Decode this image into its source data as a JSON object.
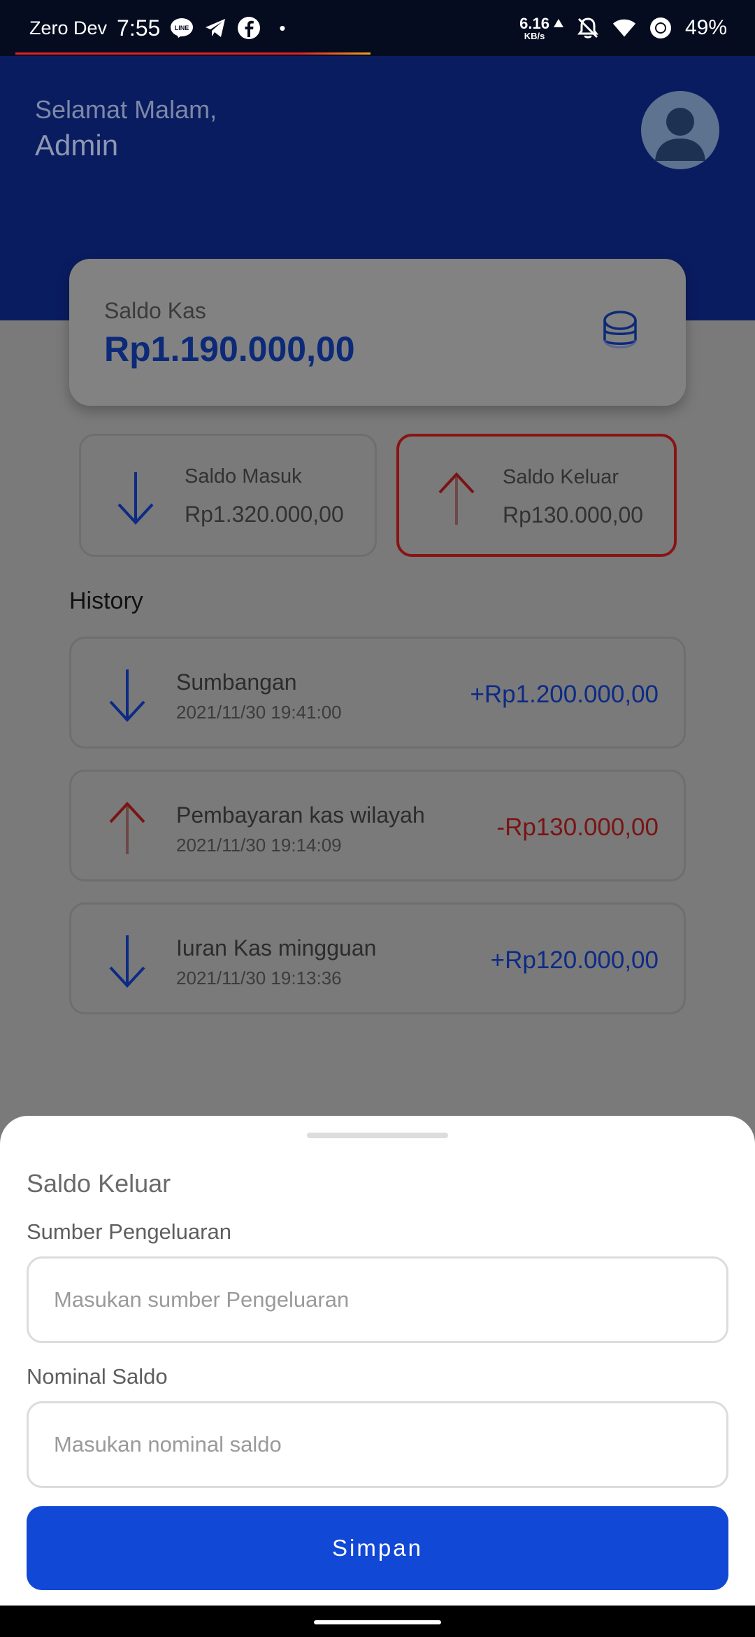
{
  "status_bar": {
    "carrier": "Zero Dev",
    "time": "7:55",
    "net_speed_value": "6.16",
    "net_speed_unit": "KB/s",
    "battery": "49%",
    "icons": [
      "line-icon",
      "telegram-icon",
      "facebook-icon",
      "dot",
      "upload-arrow-icon",
      "bell-off-icon",
      "wifi-icon",
      "battery-saver-icon"
    ]
  },
  "header": {
    "greeting": "Selamat Malam,",
    "user_name": "Admin"
  },
  "balance": {
    "label": "Saldo Kas",
    "value": "Rp1.190.000,00"
  },
  "summary": {
    "income": {
      "label": "Saldo Masuk",
      "value": "Rp1.320.000,00"
    },
    "expense": {
      "label": "Saldo Keluar",
      "value": "Rp130.000,00"
    }
  },
  "history": {
    "title": "History",
    "items": [
      {
        "name": "Sumbangan",
        "date": "2021/11/30 19:41:00",
        "amount": "+Rp1.200.000,00",
        "type": "in"
      },
      {
        "name": "Pembayaran kas wilayah",
        "date": "2021/11/30 19:14:09",
        "amount": "-Rp130.000,00",
        "type": "out"
      },
      {
        "name": "Iuran Kas mingguan",
        "date": "2021/11/30 19:13:36",
        "amount": "+Rp120.000,00",
        "type": "in"
      }
    ]
  },
  "sheet": {
    "title": "Saldo Keluar",
    "source_label": "Sumber Pengeluaran",
    "source_placeholder": "Masukan sumber Pengeluaran",
    "source_value": "",
    "amount_label": "Nominal Saldo",
    "amount_placeholder": "Masukan nominal saldo",
    "amount_value": "",
    "save_label": "Simpan"
  },
  "colors": {
    "header_bg": "#0a1c60",
    "primary_button": "#1248d6",
    "income_accent": "#0d2b85",
    "expense_accent": "#7a1414"
  }
}
